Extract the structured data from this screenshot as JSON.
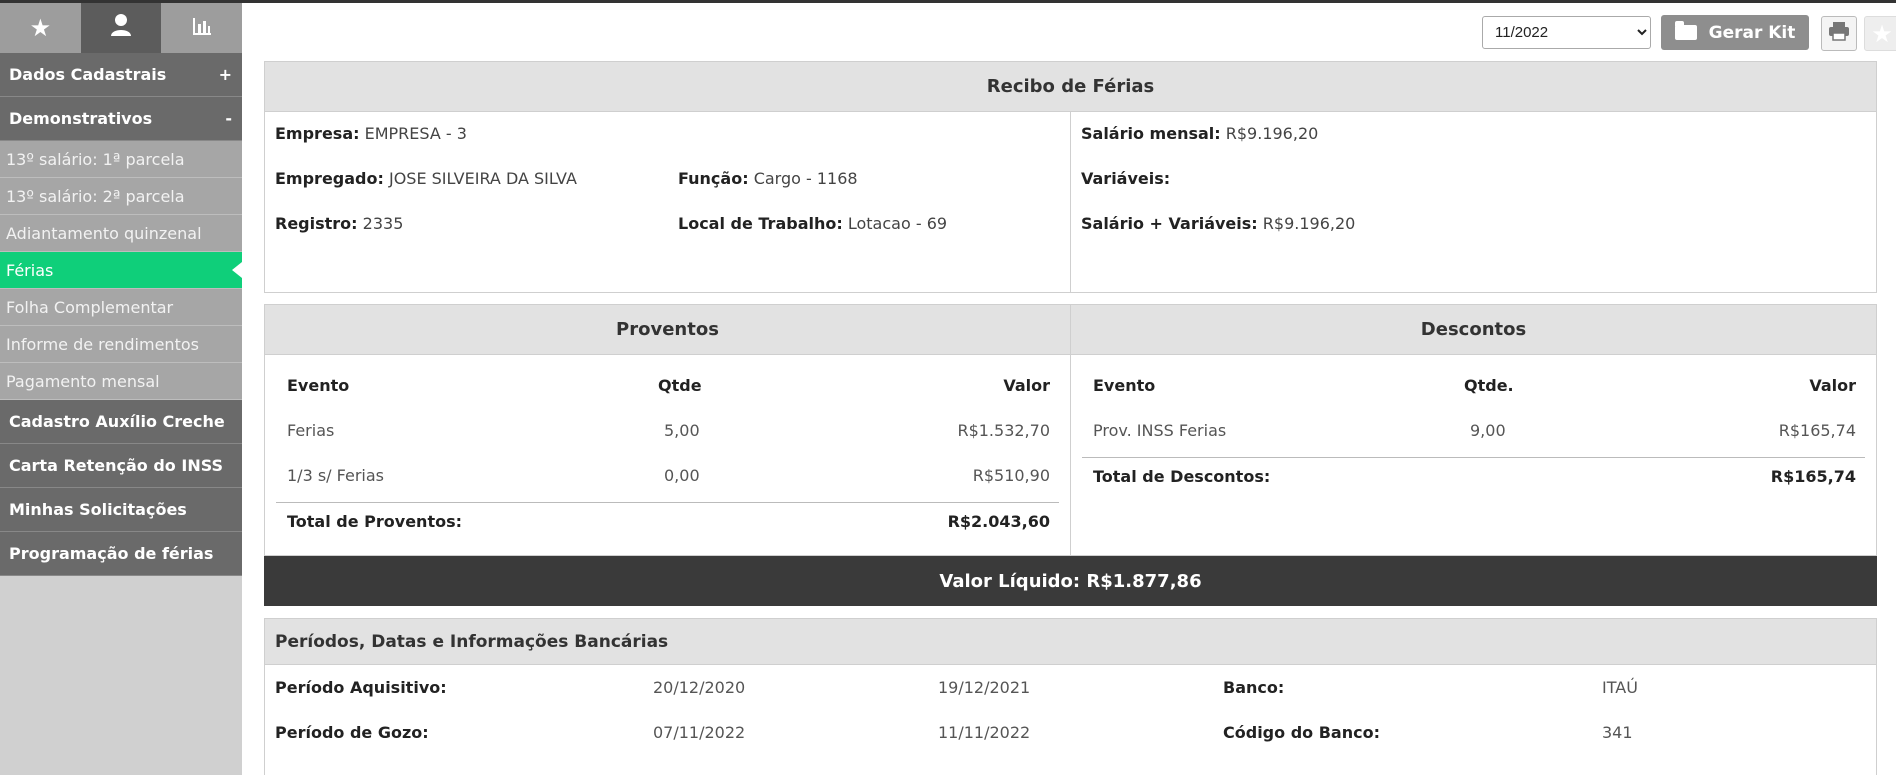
{
  "sidebar": {
    "tabs": [
      {
        "icon": "star-icon",
        "glyph": "★"
      },
      {
        "icon": "user-icon",
        "glyph": "👤"
      },
      {
        "icon": "bar-chart-icon",
        "glyph": "📊"
      }
    ],
    "sections": {
      "dados_cadastrais": {
        "label": "Dados Cadastrais",
        "toggle": "+"
      },
      "demonstrativos": {
        "label": "Demonstrativos",
        "toggle": "-"
      },
      "auxilio_creche": {
        "label": "Cadastro Auxílio Creche"
      },
      "carta_inss": {
        "label": "Carta Retenção do INSS"
      },
      "solicitacoes": {
        "label": "Minhas Solicitações"
      },
      "programacao": {
        "label": "Programação de férias"
      }
    },
    "demonstrativos_items": [
      "13º salário: 1ª parcela",
      "13º salário: 2ª parcela",
      "Adiantamento quinzenal",
      "Férias",
      "Folha Complementar",
      "Informe de rendimentos",
      "Pagamento mensal"
    ],
    "active_item": "Férias"
  },
  "toolbar": {
    "period": "11/2022",
    "gerar_kit": "Gerar Kit"
  },
  "recibo": {
    "title": "Recibo de Férias",
    "empresa_label": "Empresa:",
    "empresa": "EMPRESA - 3",
    "empregado_label": "Empregado:",
    "empregado": "JOSE SILVEIRA DA SILVA",
    "funcao_label": "Função:",
    "funcao": "Cargo - 1168",
    "registro_label": "Registro:",
    "registro": "2335",
    "local_label": "Local de Trabalho:",
    "local": "Lotacao - 69",
    "salario_label": "Salário mensal:",
    "salario": "R$9.196,20",
    "variaveis_label": "Variáveis:",
    "sal_var_label": "Salário + Variáveis:",
    "sal_var": "R$9.196,20"
  },
  "proventos": {
    "title": "Proventos",
    "headers": {
      "evento": "Evento",
      "qtde": "Qtde",
      "valor": "Valor"
    },
    "rows": [
      {
        "evento": "Ferias",
        "qtde": "5,00",
        "valor": "R$1.532,70"
      },
      {
        "evento": "1/3 s/ Ferias",
        "qtde": "0,00",
        "valor": "R$510,90"
      }
    ],
    "total_label": "Total de Proventos:",
    "total": "R$2.043,60"
  },
  "descontos": {
    "title": "Descontos",
    "headers": {
      "evento": "Evento",
      "qtde": "Qtde.",
      "valor": "Valor"
    },
    "rows": [
      {
        "evento": "Prov. INSS Ferias",
        "qtde": "9,00",
        "valor": "R$165,74"
      }
    ],
    "total_label": "Total de Descontos:",
    "total": "R$165,74"
  },
  "liquido": "Valor Líquido: R$1.877,86",
  "periodos": {
    "title": "Períodos, Datas e Informações Bancárias",
    "aquisitivo_label": "Período Aquisitivo:",
    "aquisitivo_inicio": "20/12/2020",
    "aquisitivo_fim": "19/12/2021",
    "gozo_label": "Período de Gozo:",
    "gozo_inicio": "07/11/2022",
    "gozo_fim": "11/11/2022",
    "banco_label": "Banco:",
    "banco": "ITAÚ",
    "codigo_banco_label": "Código do Banco:",
    "codigo_banco": "341"
  }
}
